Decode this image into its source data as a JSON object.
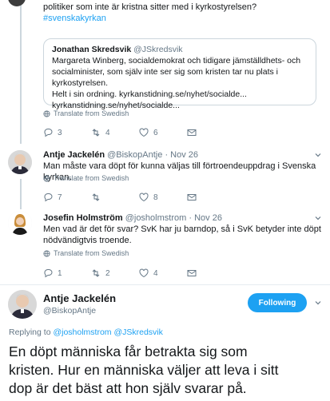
{
  "top_tweet": {
    "text_cut": "politiker som inte är kristna sitter med i kyrkostyrelsen?",
    "hashtag": "#svenskakyrkan",
    "quote": {
      "name": "Jonathan Skredsvik",
      "handle": "@JSkredsvik",
      "line1": "Margareta Winberg, socialdemokrat och tidigare jämställdhets- och",
      "line2": "socialminister, som själv inte ser sig som kristen tar nu plats i kyrkostyrelsen.",
      "line3": "Helt i sin ordning. kyrkanstidning.se/nyhet/socialde...",
      "line4": "kyrkanstidning.se/nyhet/socialde..."
    },
    "translate_label": "Translate from Swedish",
    "replies": "3",
    "retweets": "4",
    "likes": "6"
  },
  "reply1": {
    "name": "Antje Jackelén",
    "handle": "@BiskopAntje",
    "time": "Nov 26",
    "text": "Man måste vara döpt för kunna väljas till förtroendeuppdrag i Svenska kyrkan.",
    "translate_label": "Translate from Swedish",
    "replies": "7",
    "retweets": "",
    "likes": "8"
  },
  "reply2": {
    "name": "Josefin Holmström",
    "handle": "@josholmstrom",
    "time": "Nov 26",
    "line1": "Men vad är det för svar? SvK har ju barndop, så i SvK betyder inte döpt",
    "line2": "nödvändigtvis troende.",
    "translate_label": "Translate from Swedish",
    "replies": "1",
    "retweets": "2",
    "likes": "4"
  },
  "main_tweet": {
    "name": "Antje Jackelén",
    "handle": "@BiskopAntje",
    "follow_label": "Following",
    "replying_prefix": "Replying to",
    "replying_to": "@josholmstrom @JSkredsvik",
    "line1": "En döpt människa får betrakta sig som",
    "line2": "kristen. Hur en människa väljer att leva i sitt",
    "line3": "dop är det bäst att hon själv svarar på."
  },
  "colors": {
    "accent": "#1da1f2",
    "muted": "#657786",
    "border": "#e6ecf0"
  }
}
